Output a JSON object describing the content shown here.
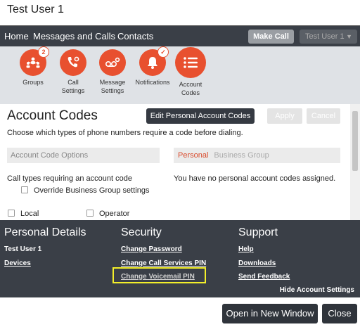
{
  "window": {
    "title": "Test User 1"
  },
  "nav": {
    "links": [
      "Home",
      "Messages and Calls",
      "Contacts"
    ],
    "make_call": "Make Call",
    "user_menu": "Test User 1",
    "caret": "▼"
  },
  "toolbar": {
    "items": [
      {
        "label": "Groups",
        "icon": "groups-icon",
        "badge": "2"
      },
      {
        "label": "Call\nSettings",
        "icon": "call-settings-icon"
      },
      {
        "label": "Message\nSettings",
        "icon": "message-settings-icon"
      },
      {
        "label": "Notifications",
        "icon": "notifications-icon",
        "badge": "✓"
      },
      {
        "label": "Account\nCodes",
        "icon": "account-codes-icon"
      }
    ],
    "accent": "#e8502f"
  },
  "main": {
    "heading": "Account Codes",
    "edit_button": "Edit Personal Account Codes",
    "apply_button": "Apply",
    "cancel_button": "Cancel",
    "description": "Choose which types of phone numbers require a code before dialing.",
    "options_placeholder": "Account Code Options",
    "tab_personal": "Personal",
    "tab_business": "Business Group",
    "call_types_label": "Call types requiring an account code",
    "override_label": "Override Business Group settings",
    "no_personal": "You have no personal account codes assigned.",
    "local_label": "Local",
    "operator_label": "Operator"
  },
  "footer": {
    "personal": {
      "title": "Personal Details",
      "name": "Test User 1",
      "devices": "Devices"
    },
    "security": {
      "title": "Security",
      "change_password": "Change Password",
      "change_call_pin": "Change Call Services PIN",
      "change_vm_pin": "Change Voicemail PIN"
    },
    "support": {
      "title": "Support",
      "help": "Help",
      "downloads": "Downloads",
      "feedback": "Send Feedback"
    },
    "hide_settings": "Hide Account Settings",
    "highlight_color": "#f3ef2a"
  },
  "actions": {
    "open_new_window": "Open in New Window",
    "close": "Close"
  }
}
